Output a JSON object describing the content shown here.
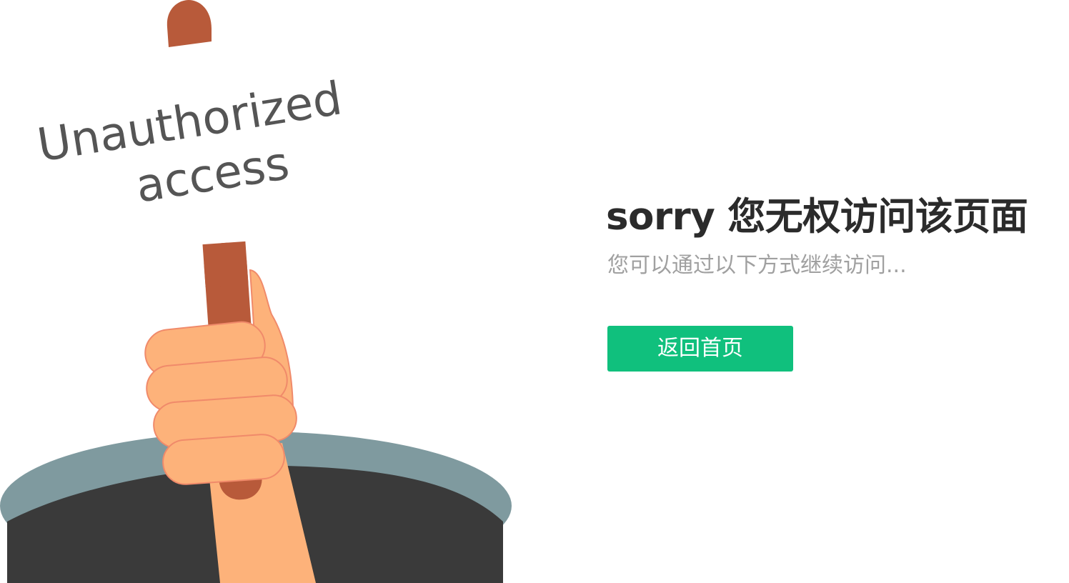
{
  "illustration": {
    "sign_line1": "Unauthorized",
    "sign_line2": "access"
  },
  "message": {
    "title": "sorry 您无权访问该页面",
    "subtitle": "您可以通过以下方式继续访问..."
  },
  "actions": {
    "home_label": "返回首页"
  },
  "colors": {
    "accent": "#10c07d",
    "handle": "#b85a3a",
    "skin": "#fdb27a",
    "hole_rim": "#7f9a9f",
    "hole_inner": "#3a3a3a",
    "title": "#2b2b2b",
    "subtitle": "#a0a0a0"
  }
}
